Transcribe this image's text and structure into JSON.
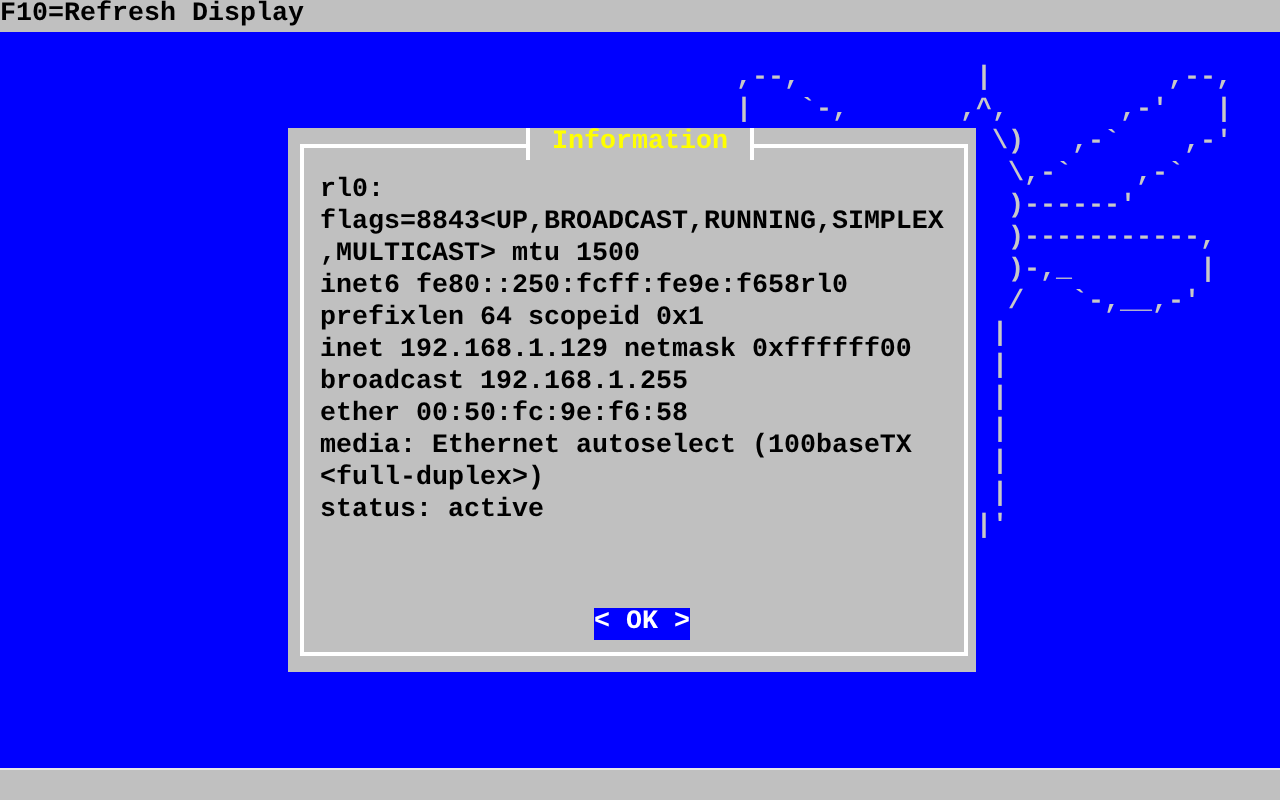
{
  "top_bar": {
    "text": "F10=Refresh Display"
  },
  "art_top": [
    ",--,           |           ,--,",
    "|   `-,       ,^,       ,-'   |"
  ],
  "art_side": [
    " \\)   ,-`    ,-'",
    "  \\,-`    ,-`",
    "  )------'",
    "  )-----------,",
    "  )-,_        |",
    "  /   `-,__,-'",
    " |",
    " |",
    " |",
    " |",
    " |",
    " |",
    "|'"
  ],
  "dialog": {
    "title": "Information",
    "lines": [
      "rl0:",
      "flags=8843<UP,BROADCAST,RUNNING,SIMPLEX",
      ",MULTICAST> mtu 1500",
      "inet6 fe80::250:fcff:fe9e:f658rl0",
      "prefixlen 64 scopeid 0x1",
      "inet 192.168.1.129 netmask 0xffffff00",
      "broadcast 192.168.1.255",
      "ether 00:50:fc:9e:f6:58",
      "media: Ethernet autoselect (100baseTX",
      "<full-duplex>)",
      "status: active"
    ],
    "buttons": [
      {
        "label": "< OK >",
        "selected": true
      }
    ]
  }
}
